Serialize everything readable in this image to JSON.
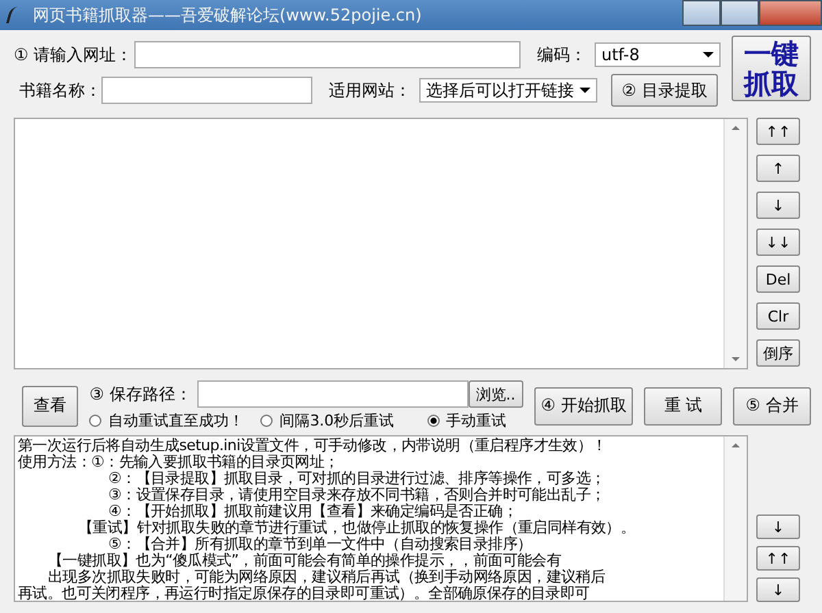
{
  "window": {
    "title": "网页书籍抓取器——吾爱破解论坛(www.52pojie.cn)"
  },
  "url_row": {
    "label": "① 请输入网址：",
    "encoding_label": "编码：",
    "encoding_value": "utf-8"
  },
  "name_row": {
    "label": "书籍名称：",
    "site_label": "适用网站：",
    "site_value": "选择后可以打开链接",
    "extract_button": "② 目录提取"
  },
  "one_click_button": "一键抓取",
  "side_buttons": [
    "↑↑",
    "↑",
    "↓",
    "↓↓",
    "Del",
    "Clr",
    "倒序"
  ],
  "save_row": {
    "view_button": "查看",
    "path_label": "③ 保存路径：",
    "browse_button": "浏览..",
    "start_button": "④ 开始抓取",
    "retry_button": "重 试",
    "merge_button": "⑤ 合并"
  },
  "retry_modes": [
    {
      "label": "自动重试直至成功！",
      "selected": false
    },
    {
      "label": "间隔3.0秒后重试",
      "selected": false
    },
    {
      "label": "手动重试",
      "selected": true
    }
  ],
  "help_lines": [
    "第一次运行后将自动生成setup.ini设置文件，可手动修改，内带说明（重启程序才生效）！",
    "使用方法：①：先输入要抓取书籍的目录页网址；",
    "②：【目录提取】抓取目录，可对抓的目录进行过滤、排序等操作，可多选；",
    "③：设置保存目录，请使用空目录来存放不同书籍，否则合并时可能出乱子；",
    "④：【开始抓取】抓取前建议用【查看】来确定编码是否正确；",
    "【重试】针对抓取失败的章节进行重试，也做停止抓取的恢复操作（重启同样有效）。",
    "⑤：【合并】所有抓取的章节到单一文件中（自动搜索目录排序）",
    "【一键抓取】也为“傻瓜模式”，前面可能会有简单的操作提示，，前面可能会有",
    "出现多次抓取失败时，可能为网络原因，建议稍后再试（换到手动网络原因，建议稍后",
    "再试。也可关闭程序，再运行时指定原保存的目录即可重试）。全部确原保存的目录即可"
  ],
  "stray_buttons": [
    "↓",
    "↑↑",
    "↓"
  ]
}
